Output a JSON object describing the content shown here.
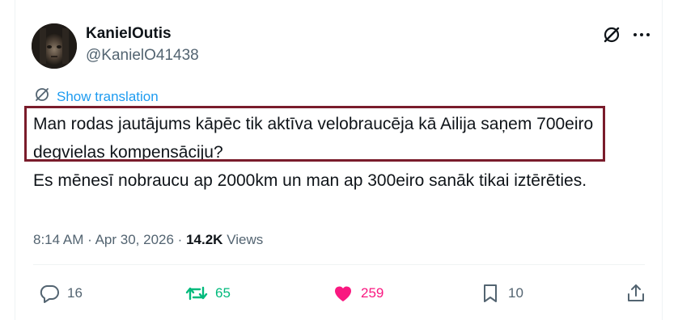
{
  "author": {
    "display_name": "KanielOutis",
    "handle": "@KanielO41438"
  },
  "header_icons": [
    "grok-icon",
    "more-icon"
  ],
  "translation": {
    "label": "Show translation",
    "icon": "globe-icon"
  },
  "tweet": {
    "paragraphs": [
      "Man rodas jautājums kāpēc tik aktīva velobraucēja kā Ailija saņem 700eiro degvielas kompensāciju?",
      "Es mēnesī nobraucu ap 2000km un man ap 300eiro sanāk tikai iztērēties."
    ]
  },
  "meta": {
    "time": "8:14 AM",
    "separator": "·",
    "date": "Apr 30, 2026",
    "views_count": "14.2K",
    "views_label": "Views"
  },
  "actions": {
    "replies": "16",
    "reposts": "65",
    "likes": "259",
    "bookmarks": "10"
  },
  "colors": {
    "text": "#0f1419",
    "secondary": "#536471",
    "link": "#1d9bf0",
    "repost_active": "#00ba7c",
    "like_active": "#f91880",
    "highlight_border": "#7a1c2b"
  }
}
